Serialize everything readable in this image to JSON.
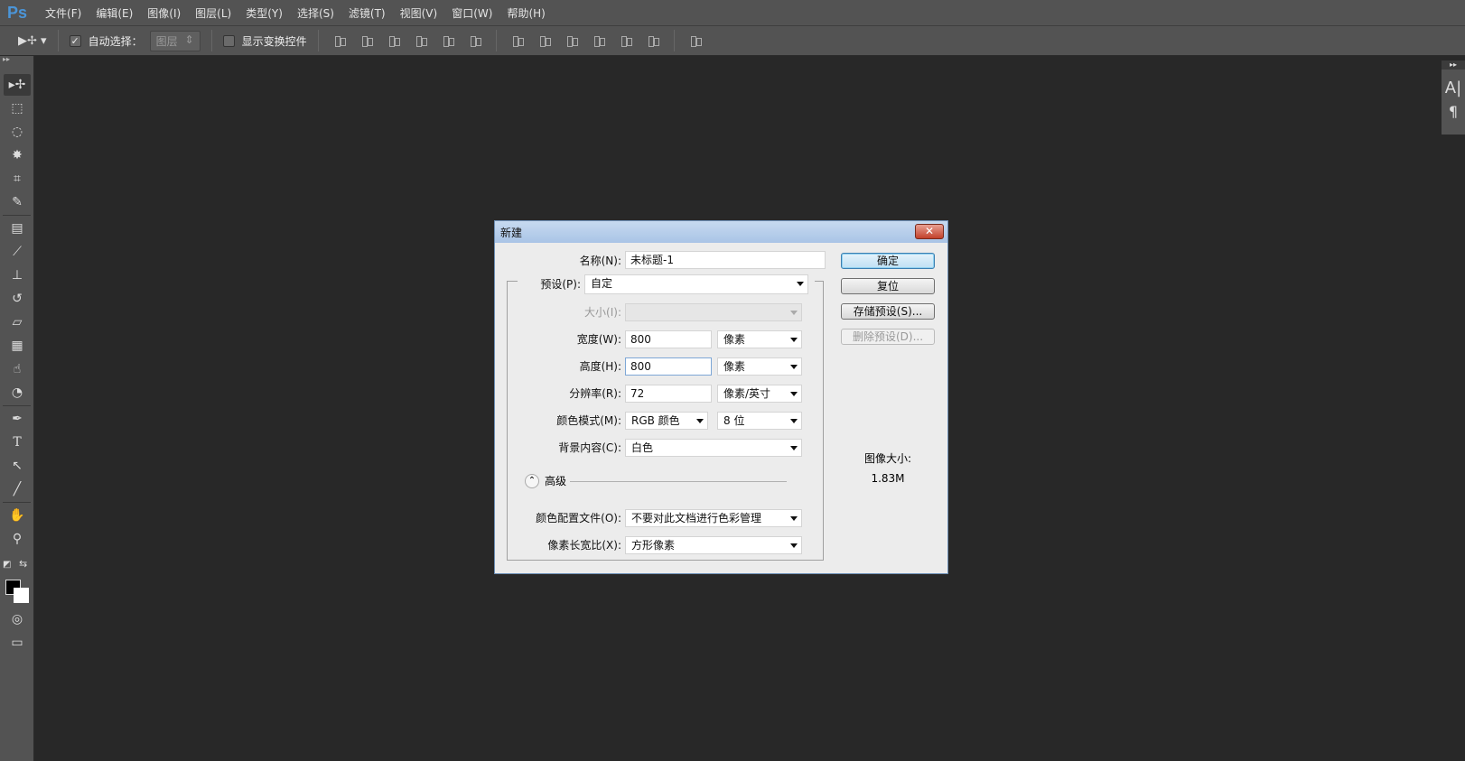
{
  "app": {
    "logo": "Ps"
  },
  "menu": [
    "文件(F)",
    "编辑(E)",
    "图像(I)",
    "图层(L)",
    "类型(Y)",
    "选择(S)",
    "滤镜(T)",
    "视图(V)",
    "窗口(W)",
    "帮助(H)"
  ],
  "options": {
    "auto_select_label": "自动选择：",
    "auto_select_checked": true,
    "auto_select_target": "图层",
    "show_transform_label": "显示变换控件",
    "show_transform_checked": false
  },
  "right_panel": {
    "char_glyph": "A|",
    "para_glyph": "¶"
  },
  "dialog": {
    "title": "新建",
    "close": "✕",
    "name_label": "名称(N):",
    "name_value": "未标题-1",
    "preset_label": "预设(P):",
    "preset_value": "自定",
    "size_label": "大小(I):",
    "size_value": "",
    "width_label": "宽度(W):",
    "width_value": "800",
    "width_unit": "像素",
    "height_label": "高度(H):",
    "height_value": "800",
    "height_unit": "像素",
    "resolution_label": "分辨率(R):",
    "resolution_value": "72",
    "resolution_unit": "像素/英寸",
    "color_mode_label": "颜色模式(M):",
    "color_mode_value": "RGB 颜色",
    "bit_depth": "8 位",
    "background_label": "背景内容(C):",
    "background_value": "白色",
    "advanced_label": "高级",
    "profile_label": "颜色配置文件(O):",
    "profile_value": "不要对此文档进行色彩管理",
    "aspect_label": "像素长宽比(X):",
    "aspect_value": "方形像素",
    "buttons": {
      "ok": "确定",
      "reset": "复位",
      "save_preset": "存储预设(S)...",
      "delete_preset": "删除预设(D)..."
    },
    "image_size_label": "图像大小:",
    "image_size_value": "1.83M"
  }
}
